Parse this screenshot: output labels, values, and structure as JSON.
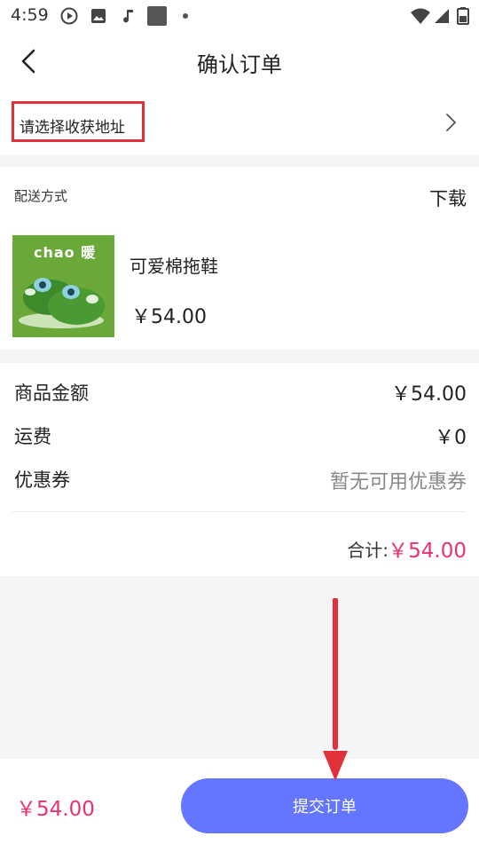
{
  "status_bar": {
    "time": "4:59"
  },
  "header": {
    "title": "确认订单"
  },
  "address": {
    "placeholder": "请选择收获地址"
  },
  "shipping": {
    "label": "配送方式",
    "value": "下载"
  },
  "product": {
    "brand_text": "chao 暖",
    "name": "可爱棉拖鞋",
    "price": "￥54.00"
  },
  "summary": {
    "rows": [
      {
        "label": "商品金额",
        "value": "￥54.00"
      },
      {
        "label": "运费",
        "value": "￥0"
      },
      {
        "label": "优惠券",
        "value": "暂无可用优惠券"
      }
    ],
    "total_label": "合计:",
    "total_value": "￥54.00"
  },
  "bottom": {
    "price": "￥54.00",
    "submit_label": "提交订单"
  },
  "colors": {
    "accent_pink": "#e8336c",
    "submit_blue": "#6476ff",
    "highlight_red": "#e0313b"
  }
}
